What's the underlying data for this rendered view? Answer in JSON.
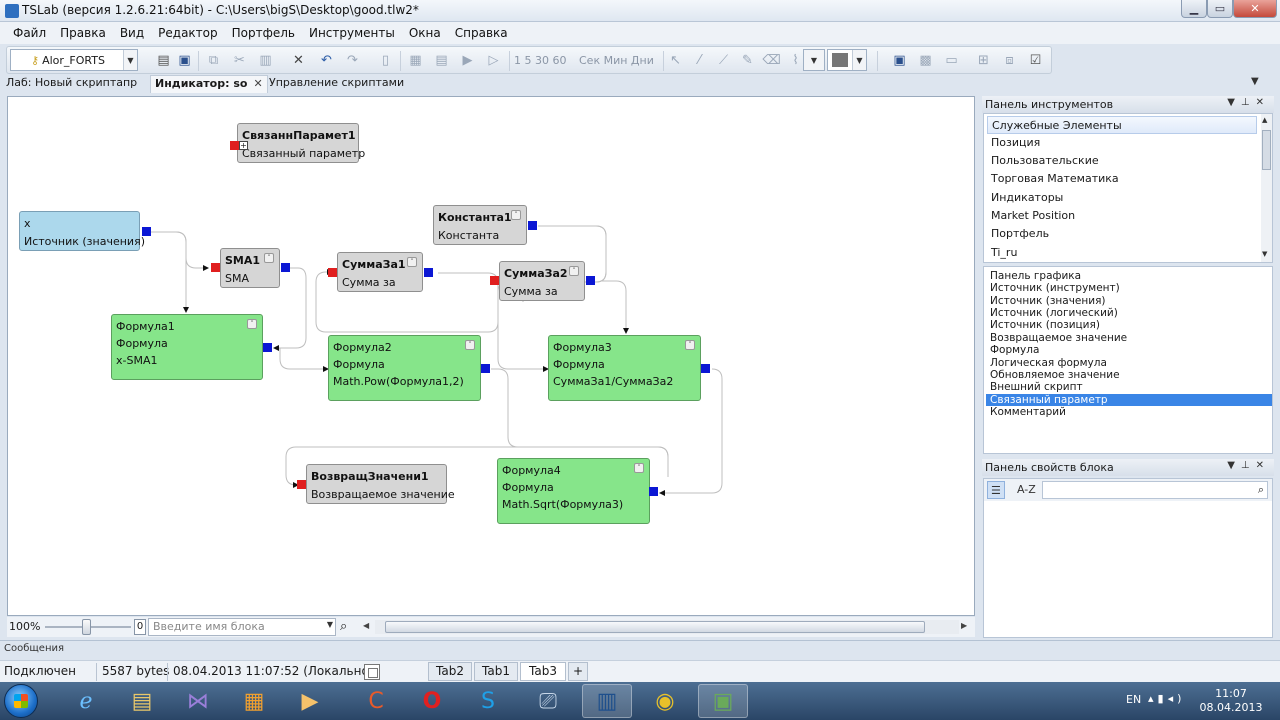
{
  "window": {
    "title": "TSLab (версия 1.2.6.21:64bit) - C:\\Users\\bigS\\Desktop\\good.tlw2*",
    "min_glyph": "▁",
    "max_glyph": "▭",
    "close_glyph": "✕"
  },
  "menu": [
    "Файл",
    "Правка",
    "Вид",
    "Редактор",
    "Портфель",
    "Инструменты",
    "Окна",
    "Справка"
  ],
  "toolbar": {
    "account": "Alor_FORTS",
    "periods": "1  5  30  60",
    "units": "Сек  Мин  Дни"
  },
  "doc_tabs": [
    {
      "label": "Лаб: Новый скриптапр"
    },
    {
      "label": "Индикатор: so",
      "close": "✕"
    },
    {
      "label": "Управление скриптами"
    }
  ],
  "nodes": {
    "linked_param": {
      "title": "СвязаннПарамет1",
      "type": "Связанный параметр"
    },
    "source": {
      "title": "x",
      "type": "Источник (значения)"
    },
    "sma": {
      "title": "SMA1",
      "type": "SMA"
    },
    "sum1": {
      "title": "СуммаЗа1",
      "type": "Сумма за"
    },
    "const": {
      "title": "Константа1",
      "type": "Константа"
    },
    "sum2": {
      "title": "СуммаЗа2",
      "type": "Сумма за"
    },
    "formula1": {
      "title": "Формула1",
      "type": "Формула",
      "expr": "x-SMA1"
    },
    "formula2": {
      "title": "Формула2",
      "type": "Формула",
      "expr": "Math.Pow(Формула1,2)"
    },
    "formula3": {
      "title": "Формула3",
      "type": "Формула",
      "expr": "СуммаЗа1/СуммаЗа2"
    },
    "retval": {
      "title": "ВозвращЗначени1",
      "type": "Возвращаемое значение"
    },
    "formula4": {
      "title": "Формула4",
      "type": "Формула",
      "expr": "Math.Sqrt(Формула3)"
    }
  },
  "canvas_bar": {
    "zoom": "100%",
    "zero": "0",
    "search_placeholder": "Введите имя блока"
  },
  "tools_panel": {
    "title": "Панель инструментов",
    "categories": [
      "Служебные Элементы",
      "Позиция",
      "Пользовательские",
      "Торговая Математика",
      "Индикаторы",
      "Market Position",
      "Портфель",
      "Ti_ru"
    ],
    "selected_category": 0,
    "elements": [
      "Панель графика",
      "Источник (инструмент)",
      "Источник (значения)",
      "Источник (логический)",
      "Источник (позиция)",
      "Возвращаемое значение",
      "Формула",
      "Логическая формула",
      "Обновляемое значение",
      "Внешний скрипт",
      "Связанный параметр",
      "Комментарий"
    ],
    "selected_element": 10
  },
  "props_panel": {
    "title": "Панель свойств блока",
    "sort_alpha": "A-Z"
  },
  "messages": {
    "label": "Сообщения"
  },
  "status": {
    "connection": "Подключен",
    "size": "5587 bytes",
    "datetime": "08.04.2013 11:07:52 (Локальное)",
    "tabs": [
      "Tab2",
      "Tab1",
      "Tab3"
    ],
    "active_tab": 2,
    "add_tab": "+"
  },
  "taskbar": {
    "lang": "EN",
    "time": "11:07",
    "date": "08.04.2013"
  },
  "colors": {
    "node_gray": "#d6d6d6",
    "node_blue": "#acd8ec",
    "node_green": "#86e58a",
    "port_in": "#e01f1f",
    "port_out": "#0b17d4",
    "selection": "#3a85e6"
  }
}
